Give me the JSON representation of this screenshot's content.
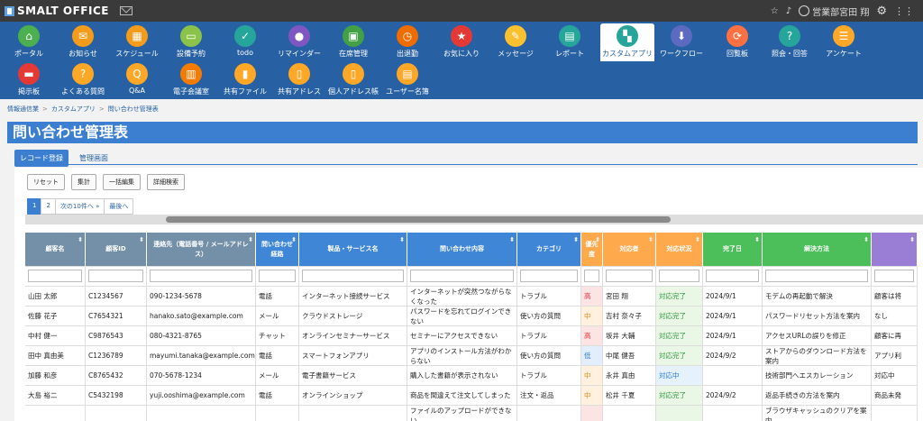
{
  "topbar": {
    "app_name": "SMALT OFFICE",
    "user_label": "営業部宮田 翔"
  },
  "nav": {
    "items": [
      {
        "label": "ポータル",
        "color": "#4caf50",
        "glyph": "⌂"
      },
      {
        "label": "お知らせ",
        "color": "#f59b1b",
        "glyph": "✉"
      },
      {
        "label": "スケジュール",
        "color": "#f59b1b",
        "glyph": "▦"
      },
      {
        "label": "設備予約",
        "color": "#8bc34a",
        "glyph": "▭"
      },
      {
        "label": "todo",
        "color": "#26a69a",
        "glyph": "✓"
      },
      {
        "label": "リマインダー",
        "color": "#7e57c2",
        "glyph": "●"
      },
      {
        "label": "在席管理",
        "color": "#43a047",
        "glyph": "▣"
      },
      {
        "label": "出退勤",
        "color": "#ef6c00",
        "glyph": "◷"
      },
      {
        "label": "お気に入り",
        "color": "#e53935",
        "glyph": "★"
      },
      {
        "label": "メッセージ",
        "color": "#fbc02d",
        "glyph": "✎"
      },
      {
        "label": "レポート",
        "color": "#26a69a",
        "glyph": "▤"
      },
      {
        "label": "カスタムアプリ",
        "color": "#26a69a",
        "glyph": "▚"
      },
      {
        "label": "ワークフロー",
        "color": "#5c6bc0",
        "glyph": "⬇"
      },
      {
        "label": "回覧板",
        "color": "#ff7043",
        "glyph": "⟳"
      },
      {
        "label": "照会・回答",
        "color": "#26a69a",
        "glyph": "?"
      },
      {
        "label": "アンケート",
        "color": "#ffa726",
        "glyph": "☰"
      },
      {
        "label": "掲示板",
        "color": "#e53935",
        "glyph": "▬"
      },
      {
        "label": "よくある質問",
        "color": "#ffa726",
        "glyph": "?"
      },
      {
        "label": "Q&A",
        "color": "#ffa726",
        "glyph": "Q"
      },
      {
        "label": "電子会議室",
        "color": "#f57c00",
        "glyph": "▥"
      },
      {
        "label": "共有ファイル",
        "color": "#ffa726",
        "glyph": "▮"
      },
      {
        "label": "共有アドレス",
        "color": "#ffa726",
        "glyph": "▯"
      },
      {
        "label": "個人アドレス帳",
        "color": "#ffa726",
        "glyph": "▯"
      },
      {
        "label": "ユーザー名簿",
        "color": "#ffa726",
        "glyph": "▤"
      }
    ],
    "active_label": "カスタムアプリ"
  },
  "breadcrumb": [
    "情報通信業",
    "カスタムアプリ",
    "問い合わせ管理表"
  ],
  "page_title": "問い合わせ管理表",
  "tabs": [
    "レコード登録",
    "管理画面"
  ],
  "toolbar": [
    "リセット",
    "集計",
    "一括編集",
    "詳細検索"
  ],
  "pager": [
    "1",
    "2",
    "次の10件へ »",
    "最後へ"
  ],
  "table": {
    "headers": [
      {
        "label": "顧客名",
        "color": "#7390a8"
      },
      {
        "label": "顧客ID",
        "color": "#7390a8"
      },
      {
        "label": "連絡先（電話番号 / メールアドレス）",
        "color": "#7390a8"
      },
      {
        "label": "問い合わせ経路",
        "color": "#3f86d6"
      },
      {
        "label": "製品・サービス名",
        "color": "#3f86d6"
      },
      {
        "label": "問い合わせ内容",
        "color": "#3f86d6"
      },
      {
        "label": "カテゴリ",
        "color": "#3f86d6"
      },
      {
        "label": "優先度",
        "color": "#ffa94d"
      },
      {
        "label": "対応者",
        "color": "#ffa94d"
      },
      {
        "label": "対応状況",
        "color": "#ffa94d"
      },
      {
        "label": "完了日",
        "color": "#4cbe5a"
      },
      {
        "label": "解決方法",
        "color": "#4cbe5a"
      },
      {
        "label": "",
        "color": "#9a7ed6"
      }
    ],
    "rows": [
      [
        "山田 太郎",
        "C1234567",
        "090-1234-5678",
        "電話",
        "インターネット接続サービス",
        "インターネットが突然つながらなくなった",
        "トラブル",
        "高",
        "宮田 翔",
        "対応完了",
        "2024/9/1",
        "モデムの再起動で解決",
        "顧客は将"
      ],
      [
        "佐藤 花子",
        "C7654321",
        "hanako.sato@example.com",
        "メール",
        "クラウドストレージ",
        "パスワードを忘れてログインできない",
        "使い方の質問",
        "中",
        "吉村 奈々子",
        "対応完了",
        "2024/9/1",
        "パスワードリセット方法を案内",
        "なし"
      ],
      [
        "中村 健一",
        "C9876543",
        "080-4321-8765",
        "チャット",
        "オンラインセミナーサービス",
        "セミナーにアクセスできない",
        "トラブル",
        "高",
        "坂井 大輔",
        "対応完了",
        "2024/9/1",
        "アクセスURLの誤りを修正",
        "顧客に再"
      ],
      [
        "田中 真由美",
        "C1236789",
        "mayumi.tanaka@example.com",
        "電話",
        "スマートフォンアプリ",
        "アプリのインストール方法がわからない",
        "使い方の質問",
        "低",
        "中尾 健吾",
        "対応完了",
        "2024/9/2",
        "ストアからのダウンロード方法を案内",
        "アプリ利"
      ],
      [
        "加藤 和彦",
        "C8765432",
        "070-5678-1234",
        "メール",
        "電子書籍サービス",
        "購入した書籍が表示されない",
        "トラブル",
        "中",
        "永井 真由",
        "対応中",
        "",
        "技術部門へエスカレーション",
        "対応中"
      ],
      [
        "大島 裕二",
        "C5432198",
        "yuji.ooshima@example.com",
        "電話",
        "オンラインショップ",
        "商品を間違えて注文してしまった",
        "注文・返品",
        "中",
        "松井 千夏",
        "対応完了",
        "2024/9/2",
        "返品手続きの方法を案内",
        "商品未発"
      ],
      [
        "",
        "",
        "",
        "",
        "",
        "ファイルのアップロードができない",
        "",
        "",
        "",
        "",
        "",
        "ブラウザキャッシュのクリアを案内",
        ""
      ]
    ]
  }
}
